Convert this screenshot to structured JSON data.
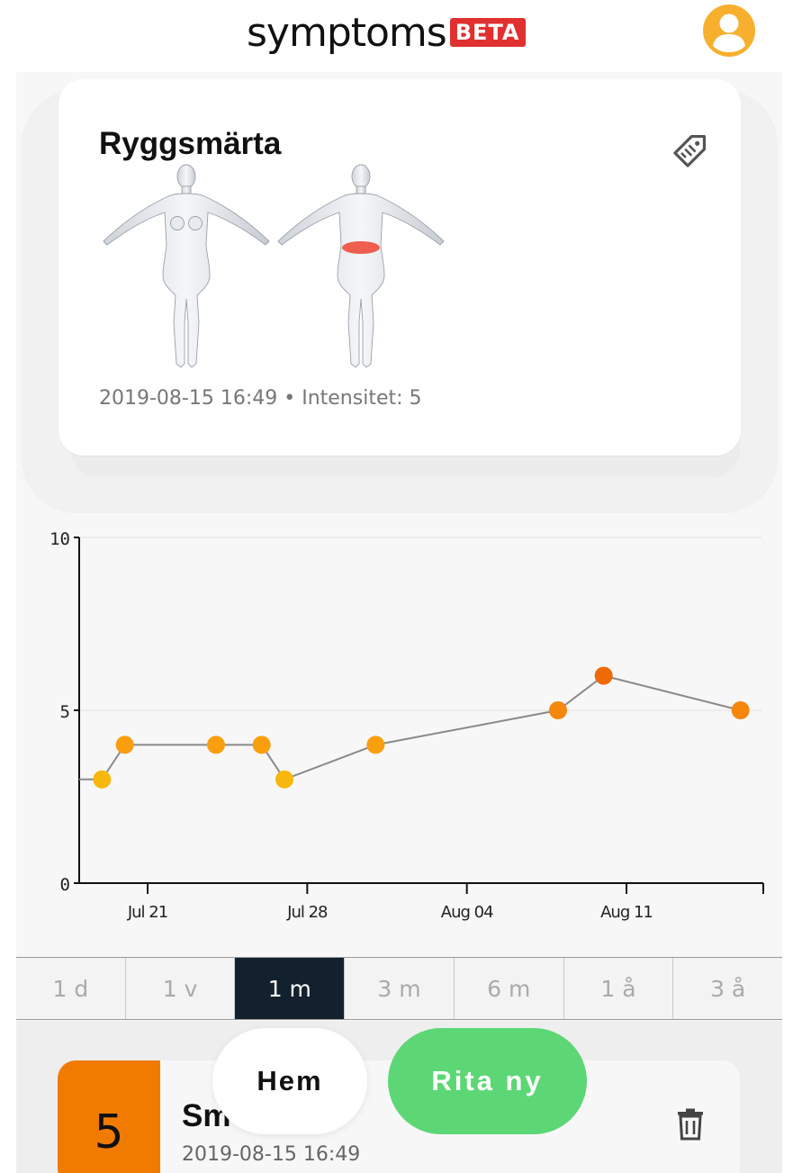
{
  "header": {
    "logo_text": "symptoms",
    "logo_badge": "BETA",
    "profile_icon": "user-circle-icon",
    "profile_color": "#f6b02e"
  },
  "symptom_card": {
    "title": "Ryggsmärta",
    "tag_icon": "tag-icon",
    "meta": "2019-08-15 16:49 • Intensitet: 5",
    "highlight_color": "#ee4a38"
  },
  "chart_data": {
    "type": "line",
    "x": [
      "2019-07-18",
      "2019-07-19",
      "2019-07-20",
      "2019-07-24",
      "2019-07-26",
      "2019-07-27",
      "2019-07-31",
      "2019-08-08",
      "2019-08-10",
      "2019-08-16"
    ],
    "y": [
      3,
      3,
      4,
      4,
      4,
      3,
      4,
      5,
      6,
      5
    ],
    "marked_x": [
      "2019-07-19",
      "2019-07-20",
      "2019-07-24",
      "2019-07-26",
      "2019-07-27",
      "2019-07-31",
      "2019-08-08",
      "2019-08-10",
      "2019-08-16"
    ],
    "marked_y": [
      3,
      4,
      4,
      4,
      3,
      4,
      5,
      6,
      5
    ],
    "ylim": [
      0,
      10
    ],
    "y_ticks": [
      "0",
      "5",
      "10"
    ],
    "x_tick_labels": [
      "Jul 21",
      "Jul 28",
      "Aug 04",
      "Aug 11"
    ],
    "x_tick_dates": [
      "2019-07-21",
      "2019-07-28",
      "2019-08-04",
      "2019-08-11"
    ],
    "xlim": [
      "2019-07-18",
      "2019-08-17"
    ],
    "grid": "horizontal",
    "line_color": "#8a8a8a",
    "point_colors": {
      "3": "#f8b70d",
      "4": "#f89e0f",
      "5": "#f5880c",
      "6": "#ef6a05"
    }
  },
  "range_tabs": [
    {
      "label": "1 d",
      "active": false
    },
    {
      "label": "1 v",
      "active": false
    },
    {
      "label": "1 m",
      "active": true
    },
    {
      "label": "3 m",
      "active": false
    },
    {
      "label": "6 m",
      "active": false
    },
    {
      "label": "1 å",
      "active": false
    },
    {
      "label": "3 å",
      "active": false
    }
  ],
  "list": {
    "items": [
      {
        "intensity": "5",
        "title": "Sm",
        "date": "2019-08-15 16:49",
        "color": "#f07b00"
      }
    ]
  },
  "actions": {
    "home_label": "Hem",
    "draw_new_label": "Rita ny",
    "draw_new_color": "#5dd775"
  }
}
